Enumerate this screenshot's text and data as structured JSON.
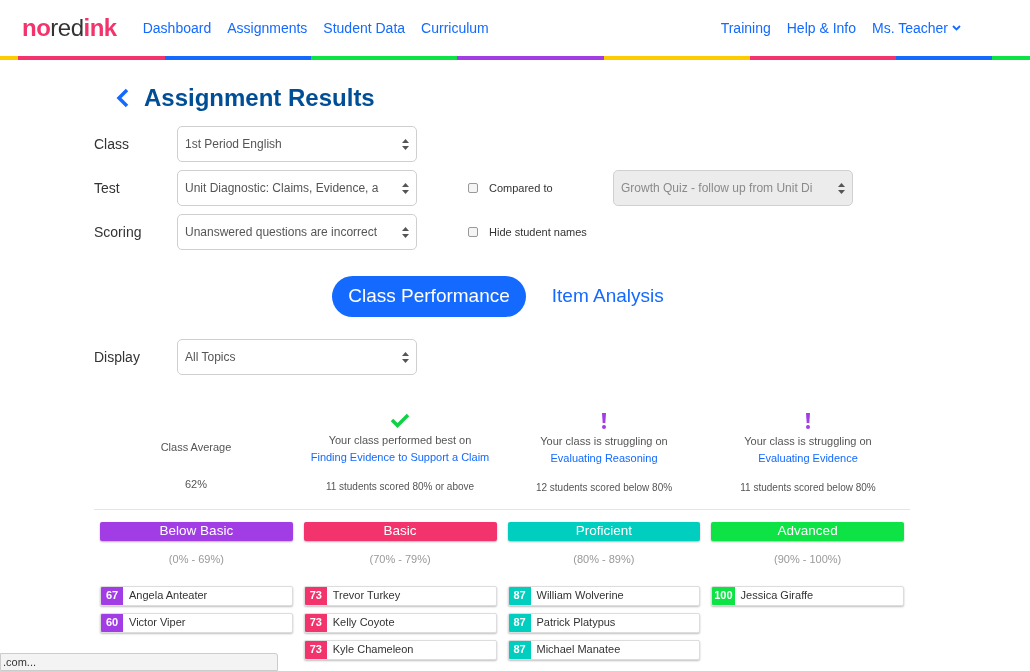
{
  "nav": {
    "logo_parts": [
      "no",
      "red",
      "ink"
    ],
    "links": [
      {
        "label": "Dashboard"
      },
      {
        "label": "Assignments"
      },
      {
        "label": "Student Data"
      },
      {
        "label": "Curriculum"
      }
    ],
    "right_links": [
      {
        "label": "Training"
      },
      {
        "label": "Help & Info"
      }
    ],
    "user_menu": "Ms. Teacher"
  },
  "title": "Assignment Results",
  "filters": [
    {
      "label": "Class",
      "value": "1st Period English"
    },
    {
      "label": "Test",
      "value": "Unit Diagnostic: Claims, Evidence, a"
    },
    {
      "label": "Scoring",
      "value": "Unanswered questions are incorrect"
    }
  ],
  "options": [
    {
      "label": "Compared to",
      "checked": false,
      "select": {
        "value": "Growth Quiz - follow up from Unit Di",
        "disabled": true
      }
    },
    {
      "label": "Hide student names",
      "checked": false
    }
  ],
  "tabs": [
    {
      "label": "Class Performance",
      "selected": true
    },
    {
      "label": "Item Analysis",
      "selected": false
    }
  ],
  "display": {
    "label": "Display",
    "value": "All Topics"
  },
  "summary": [
    {
      "kind": "average",
      "title": "Class Average",
      "value": "62%"
    },
    {
      "kind": "best",
      "title": "Your class performed best on",
      "topic": "Finding Evidence to Support a Claim",
      "note": "11 students scored 80% or above"
    },
    {
      "kind": "struggling",
      "title": "Your class is struggling on",
      "topic": "Evaluating Reasoning",
      "note": "12 students scored below 80%"
    },
    {
      "kind": "struggling",
      "title": "Your class is struggling on",
      "topic": "Evaluating Evidence",
      "note": "11 students scored below 80%"
    }
  ],
  "bands": [
    {
      "label": "Below Basic",
      "range": "(0% - 69%)",
      "color": "#a23de6",
      "students": [
        {
          "score": "67",
          "name": "Angela Anteater"
        },
        {
          "score": "60",
          "name": "Victor Viper"
        }
      ]
    },
    {
      "label": "Basic",
      "range": "(70% - 79%)",
      "color": "#f3336c",
      "students": [
        {
          "score": "73",
          "name": "Trevor Turkey"
        },
        {
          "score": "73",
          "name": "Kelly Coyote"
        },
        {
          "score": "73",
          "name": "Kyle Chameleon"
        }
      ]
    },
    {
      "label": "Proficient",
      "range": "(80% - 89%)",
      "color": "#00cfbf",
      "students": [
        {
          "score": "87",
          "name": "William Wolverine"
        },
        {
          "score": "87",
          "name": "Patrick Platypus"
        },
        {
          "score": "87",
          "name": "Michael Manatee"
        }
      ]
    },
    {
      "label": "Advanced",
      "range": "(90% - 100%)",
      "color": "#0ee345",
      "students": [
        {
          "score": "100",
          "name": "Jessica Giraffe"
        }
      ]
    }
  ],
  "status_bar": ".com..."
}
